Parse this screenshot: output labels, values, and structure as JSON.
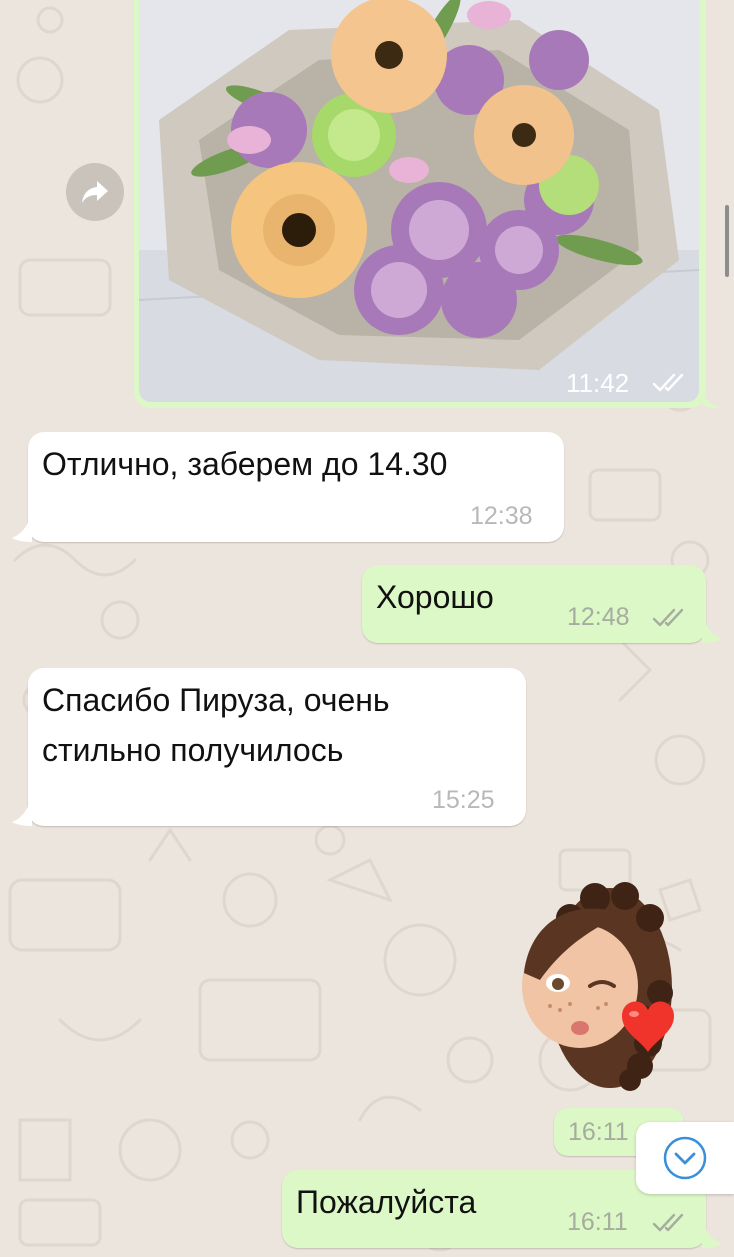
{
  "chat": {
    "photo_message": {
      "time": "11:42",
      "status": "read"
    },
    "messages": [
      {
        "direction": "incoming",
        "text": "Отлично, заберем до 14.30",
        "time": "12:38"
      },
      {
        "direction": "outgoing",
        "text": "Хорошо",
        "time": "12:48",
        "status": "read"
      },
      {
        "direction": "incoming",
        "lines": [
          "Спасибо Пируза, очень",
          "стильно получилось"
        ],
        "time": "15:25"
      },
      {
        "direction": "outgoing",
        "type": "sticker",
        "sticker": "memoji-kiss-heart-icon",
        "time": "16:11"
      },
      {
        "direction": "outgoing",
        "text": "Пожалуйста",
        "time": "16:11",
        "status": "read"
      }
    ]
  },
  "icons": {
    "forward": "forward-arrow-icon",
    "read_ticks": "double-check-icon",
    "scroll_down": "chevron-down-icon"
  },
  "colors": {
    "wallpaper": "#ece5dd",
    "incoming_bubble": "#ffffff",
    "outgoing_bubble": "#dcf8c6",
    "accent": "#3a8fd8"
  }
}
